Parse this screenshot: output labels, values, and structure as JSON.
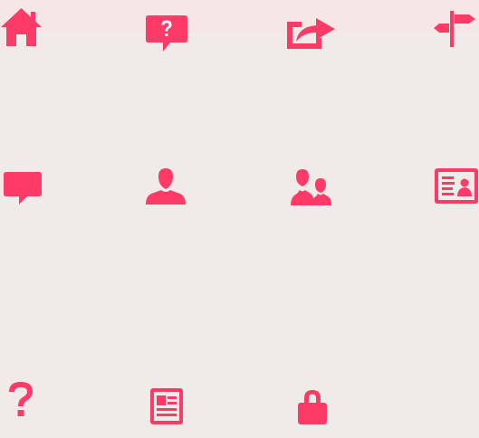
{
  "accent_color": "#fd3b66",
  "background_color": "#f0ebe8",
  "icons": [
    {
      "name": "home-icon"
    },
    {
      "name": "help-bubble-icon"
    },
    {
      "name": "share-icon"
    },
    {
      "name": "signpost-icon"
    },
    {
      "name": "chat-bubble-icon"
    },
    {
      "name": "user-icon"
    },
    {
      "name": "users-icon"
    },
    {
      "name": "id-card-icon"
    },
    {
      "name": "question-mark-icon"
    },
    {
      "name": "newspaper-icon"
    },
    {
      "name": "lock-icon"
    }
  ]
}
